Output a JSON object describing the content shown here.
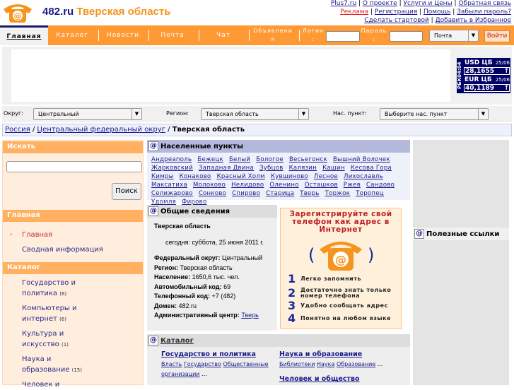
{
  "header": {
    "domain": "482.ru",
    "region": "Тверская область",
    "links_row1": [
      "Plus7.ru",
      "О проекте",
      "Услуги и Цены",
      "Обратная связь"
    ],
    "links_row2": [
      "Реклама",
      "Регистрация",
      "Помощь",
      "Забыли пароль?"
    ],
    "links_row3": [
      "Сделать стартовой",
      "Добавить в Избранное"
    ]
  },
  "nav": {
    "items": [
      "Главная",
      "Каталог",
      "Новости",
      "Почта",
      "Чат",
      "Объявлени я"
    ],
    "login_label": "Логин :",
    "password_label": "Пароль :",
    "service_select": "Почта",
    "login_button": "Войти"
  },
  "currency": {
    "source": "РБК04:04",
    "usd_label": "USD ЦБ",
    "usd_date": "25/06",
    "usd_value": "28,1655",
    "eur_label": "EUR ЦБ",
    "eur_date": "25/06",
    "eur_value": "40,1189",
    "arrow": "↑"
  },
  "filters": {
    "okrug_label": "Округ:",
    "okrug_value": "Центральный",
    "region_label": "Регион:",
    "region_value": "Тверская область",
    "place_label": "Нас. пункт:",
    "place_value": "Выберите нас. пункт"
  },
  "breadcrumb": {
    "items": [
      "Россия",
      "Центральный федеральный округ"
    ],
    "current": "Тверская область"
  },
  "sidebar": {
    "search_title": "Искать",
    "search_button": "Поиск",
    "main_title": "Главная",
    "main_items": [
      "Главная",
      "Сводная информация"
    ],
    "catalog_title": "Каталог",
    "catalog_items": [
      {
        "label": "Государство и политика",
        "count": "(6)"
      },
      {
        "label": "Компьютеры и интернет",
        "count": "(6)"
      },
      {
        "label": "Культура и искусство",
        "count": "(1)"
      },
      {
        "label": "Наука и образование",
        "count": "(15)"
      },
      {
        "label": "Человек и",
        "count": ""
      }
    ]
  },
  "towns": {
    "title": "Населенные пункты",
    "items": [
      "Андреаполь",
      "Бежецк",
      "Белый",
      "Бологое",
      "Весьегонск",
      "Вышний Волочек",
      "Жарковский",
      "Западная Двина",
      "Зубцов",
      "Калязин",
      "Кашин",
      "Кесова Гора",
      "Кимры",
      "Конаково",
      "Красный Холм",
      "Кувшиново",
      "Лесное",
      "Лихославль",
      "Максатиха",
      "Молоково",
      "Нелидово",
      "Оленино",
      "Осташков",
      "Ржев",
      "Сандово",
      "Селижарово",
      "Сонково",
      "Спирово",
      "Старица",
      "Тверь",
      "Торжок",
      "Торопец",
      "Удомля",
      "Фирово"
    ]
  },
  "info": {
    "title": "Общие сведения",
    "name": "Тверская область",
    "today": "сегодня: суббота, 25 июня 2011 г.",
    "rows": [
      {
        "k": "Федеральный округ:",
        "v": "Центральный"
      },
      {
        "k": "Регион:",
        "v": "Тверская область"
      },
      {
        "k": "Население:",
        "v": "1650,6 тыс. чел."
      },
      {
        "k": "Автомобильный код:",
        "v": "69"
      },
      {
        "k": "Телефонный код:",
        "v": "+7 (482)"
      },
      {
        "k": "Домен:",
        "v": "482.ru"
      }
    ],
    "center_label": "Административный центр:",
    "center_value": "Тверь"
  },
  "ad": {
    "title": "Зарегистрируйте свой телефон как адрес в Интернет",
    "items": [
      {
        "n": "1",
        "t": "Легко запомнить"
      },
      {
        "n": "2",
        "t": "Достаточно знать только номер телефона"
      },
      {
        "n": "3",
        "t": "Удобно сообщать адрес"
      },
      {
        "n": "4",
        "t": "Понятно на любом языке"
      }
    ]
  },
  "catalog": {
    "title": "Каталог",
    "sections": [
      {
        "title": "Государство и политика",
        "links": [
          "Власть",
          "Государство",
          "Общественные организации"
        ],
        "more": "..."
      },
      {
        "title": "Наука и образование",
        "links": [
          "Библиотеки",
          "Наука",
          "Образование"
        ],
        "more": "..."
      },
      {
        "title": "Человек и общество",
        "links": [],
        "more": ""
      }
    ]
  },
  "right": {
    "title": "Полезные ссылки"
  }
}
